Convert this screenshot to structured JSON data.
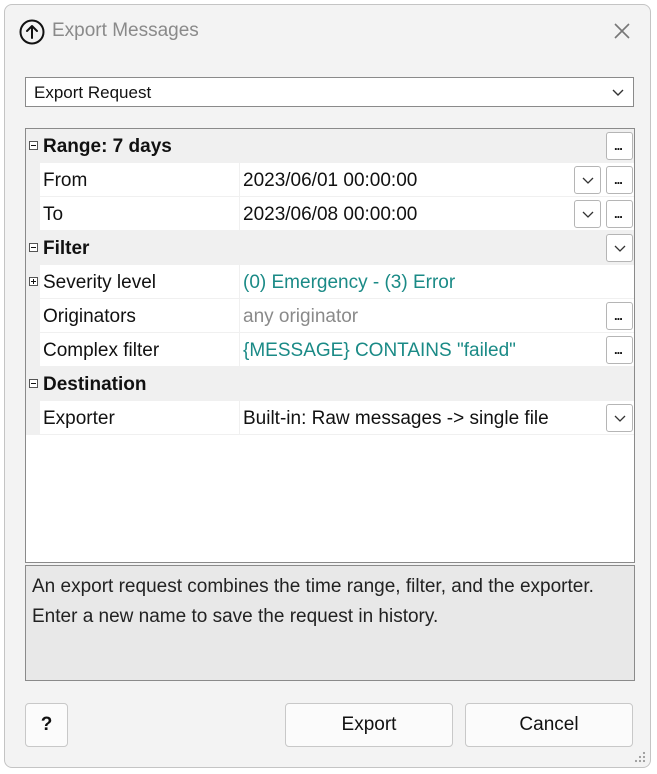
{
  "window": {
    "title": "Export Messages",
    "icons": {
      "app": "upload-arrow-circle-icon",
      "close": "close-icon"
    }
  },
  "request_dropdown": {
    "selected": "Export Request"
  },
  "grid": {
    "range": {
      "label": "Range: 7 days",
      "from": {
        "name": "From",
        "value": "2023/06/01 00:00:00"
      },
      "to": {
        "name": "To",
        "value": "2023/06/08 00:00:00"
      }
    },
    "filter": {
      "label": "Filter",
      "severity": {
        "name": "Severity level",
        "value": "(0) Emergency - (3) Error"
      },
      "originators": {
        "name": "Originators",
        "value": "any originator"
      },
      "complex": {
        "name": "Complex filter",
        "value": "{MESSAGE} CONTAINS \"failed\""
      }
    },
    "destination": {
      "label": "Destination",
      "exporter": {
        "name": "Exporter",
        "value": "Built-in: Raw messages -> single file"
      }
    }
  },
  "description": "An export request combines the time range, filter, and the exporter. Enter a new name to save the request in history.",
  "buttons": {
    "help": "?",
    "export": "Export",
    "cancel": "Cancel"
  },
  "colors": {
    "accent_teal": "#1a8a86",
    "muted_gray": "#8a8a8a"
  }
}
